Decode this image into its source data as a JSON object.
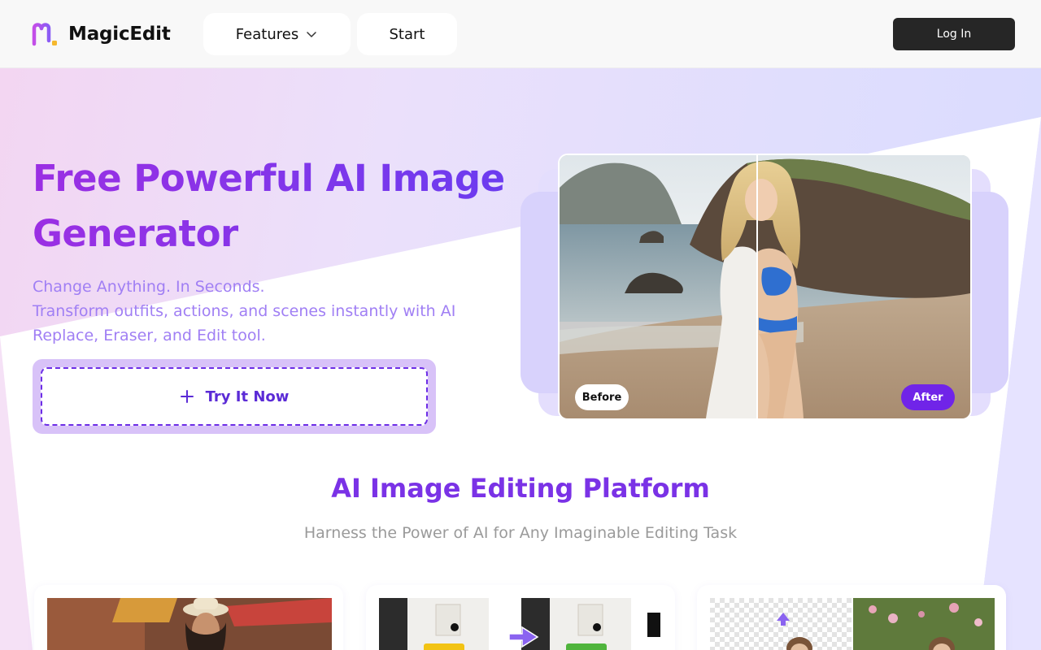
{
  "brand": {
    "name": "MagicEdit"
  },
  "nav": {
    "features_label": "Features",
    "start_label": "Start",
    "login_label": "Log In"
  },
  "hero": {
    "title_line1": "Free Powerful AI Image",
    "title_line2": "Generator",
    "subtitle_line1": "Change Anything. In Seconds.",
    "subtitle_line2": "Transform outfits, actions, and scenes instantly with AI",
    "subtitle_line3": "Replace, Eraser, and Edit tool.",
    "cta_label": "Try It Now"
  },
  "comparison": {
    "before_label": "Before",
    "after_label": "After"
  },
  "platform": {
    "title": "AI Image Editing Platform",
    "subtitle": "Harness the Power of AI for Any Imaginable Editing Task"
  },
  "colors": {
    "accent_purple": "#7024e8",
    "title_gradient_start": "#9b2fe3",
    "title_gradient_end": "#6a3cf0",
    "subtitle_purple": "#a07ff4",
    "login_bg": "#262626"
  },
  "icons": [
    "logo-icon",
    "chevron-down-icon",
    "plus-icon",
    "arrow-right-icon",
    "arrow-up-icon"
  ]
}
